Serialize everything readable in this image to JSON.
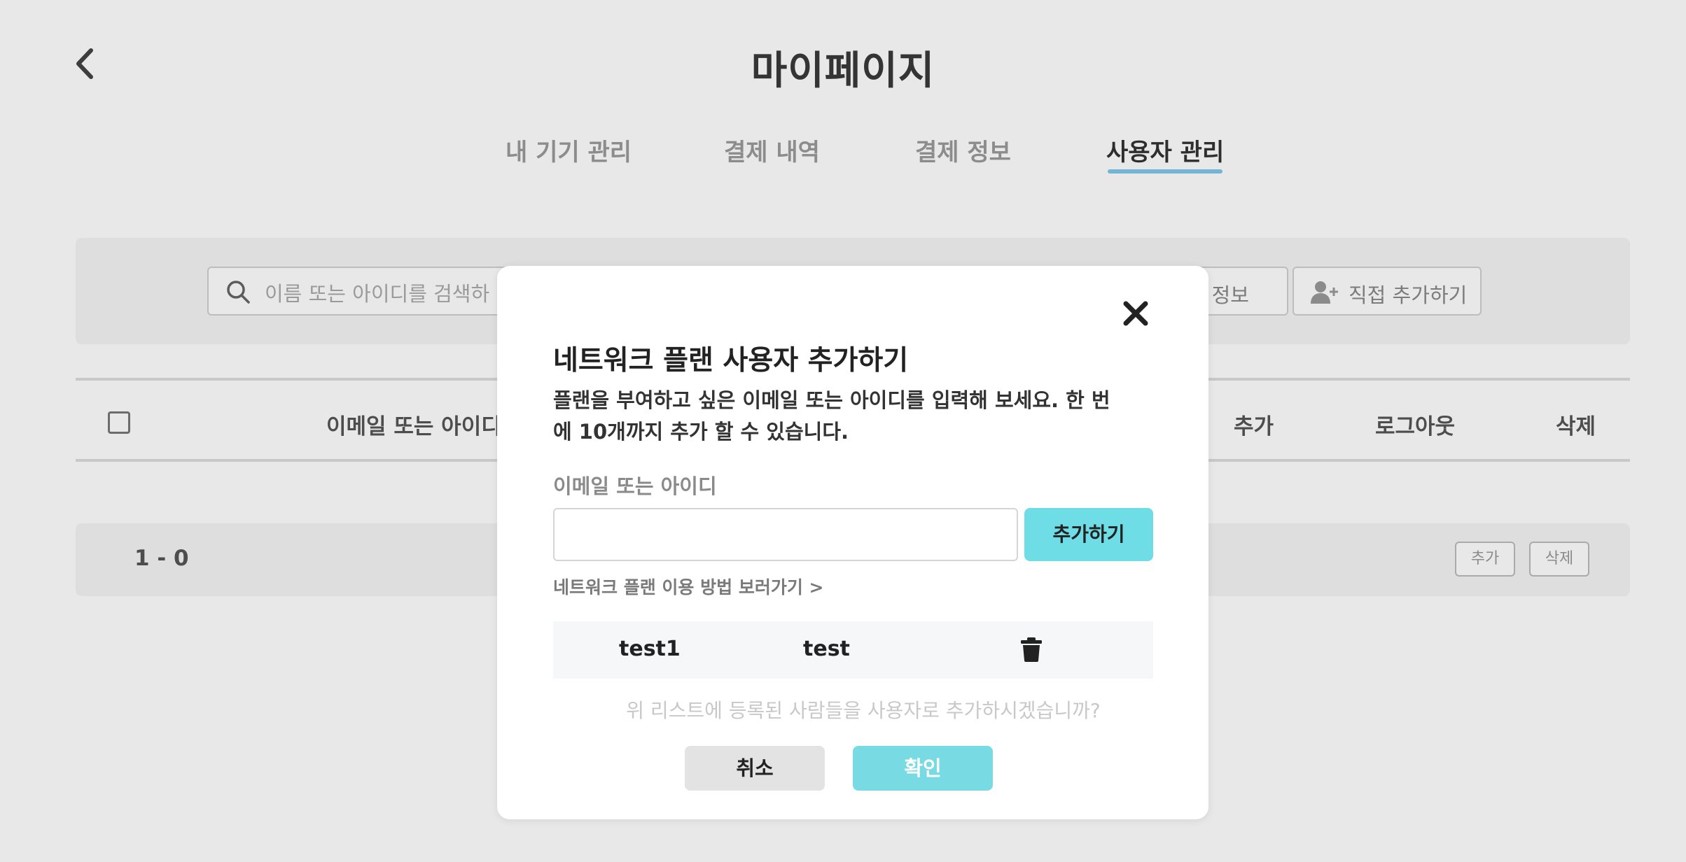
{
  "header": {
    "title": "마이페이지"
  },
  "tabs": [
    {
      "label": "내 기기 관리",
      "active": false
    },
    {
      "label": "결제 내역",
      "active": false
    },
    {
      "label": "결제 정보",
      "active": false
    },
    {
      "label": "사용자 관리",
      "active": true
    }
  ],
  "toolbar": {
    "search_placeholder": "이름 또는 아이디를 검색하",
    "info_label": "정보",
    "direct_add_label": "직접 추가하기"
  },
  "table": {
    "columns": {
      "email": "이메일 또는 아이디",
      "add": "추가",
      "logout": "로그아웃",
      "delete": "삭제"
    }
  },
  "footer": {
    "range": "1 - 0",
    "add_label": "추가",
    "delete_label": "삭제"
  },
  "modal": {
    "title": "네트워크 플랜 사용자 추가하기",
    "description": "플랜을 부여하고 싶은 이메일 또는 아이디를 입력해 보세요. 한 번에 10개까지 추가 할 수 있습니다.",
    "field_label": "이메일 또는 아이디",
    "input_value": "",
    "add_button": "추가하기",
    "howto_link": "네트워크 플랜 이용 방법 보러가기 >",
    "users": [
      {
        "id": "test1",
        "name": "test"
      }
    ],
    "confirm_question": "위 리스트에 등록된 사람들을 사용자로 추가하시겠습니까?",
    "cancel_label": "취소",
    "ok_label": "확인"
  },
  "colors": {
    "accent": "#6fdde6",
    "tab_underline": "#7fc7e8"
  }
}
